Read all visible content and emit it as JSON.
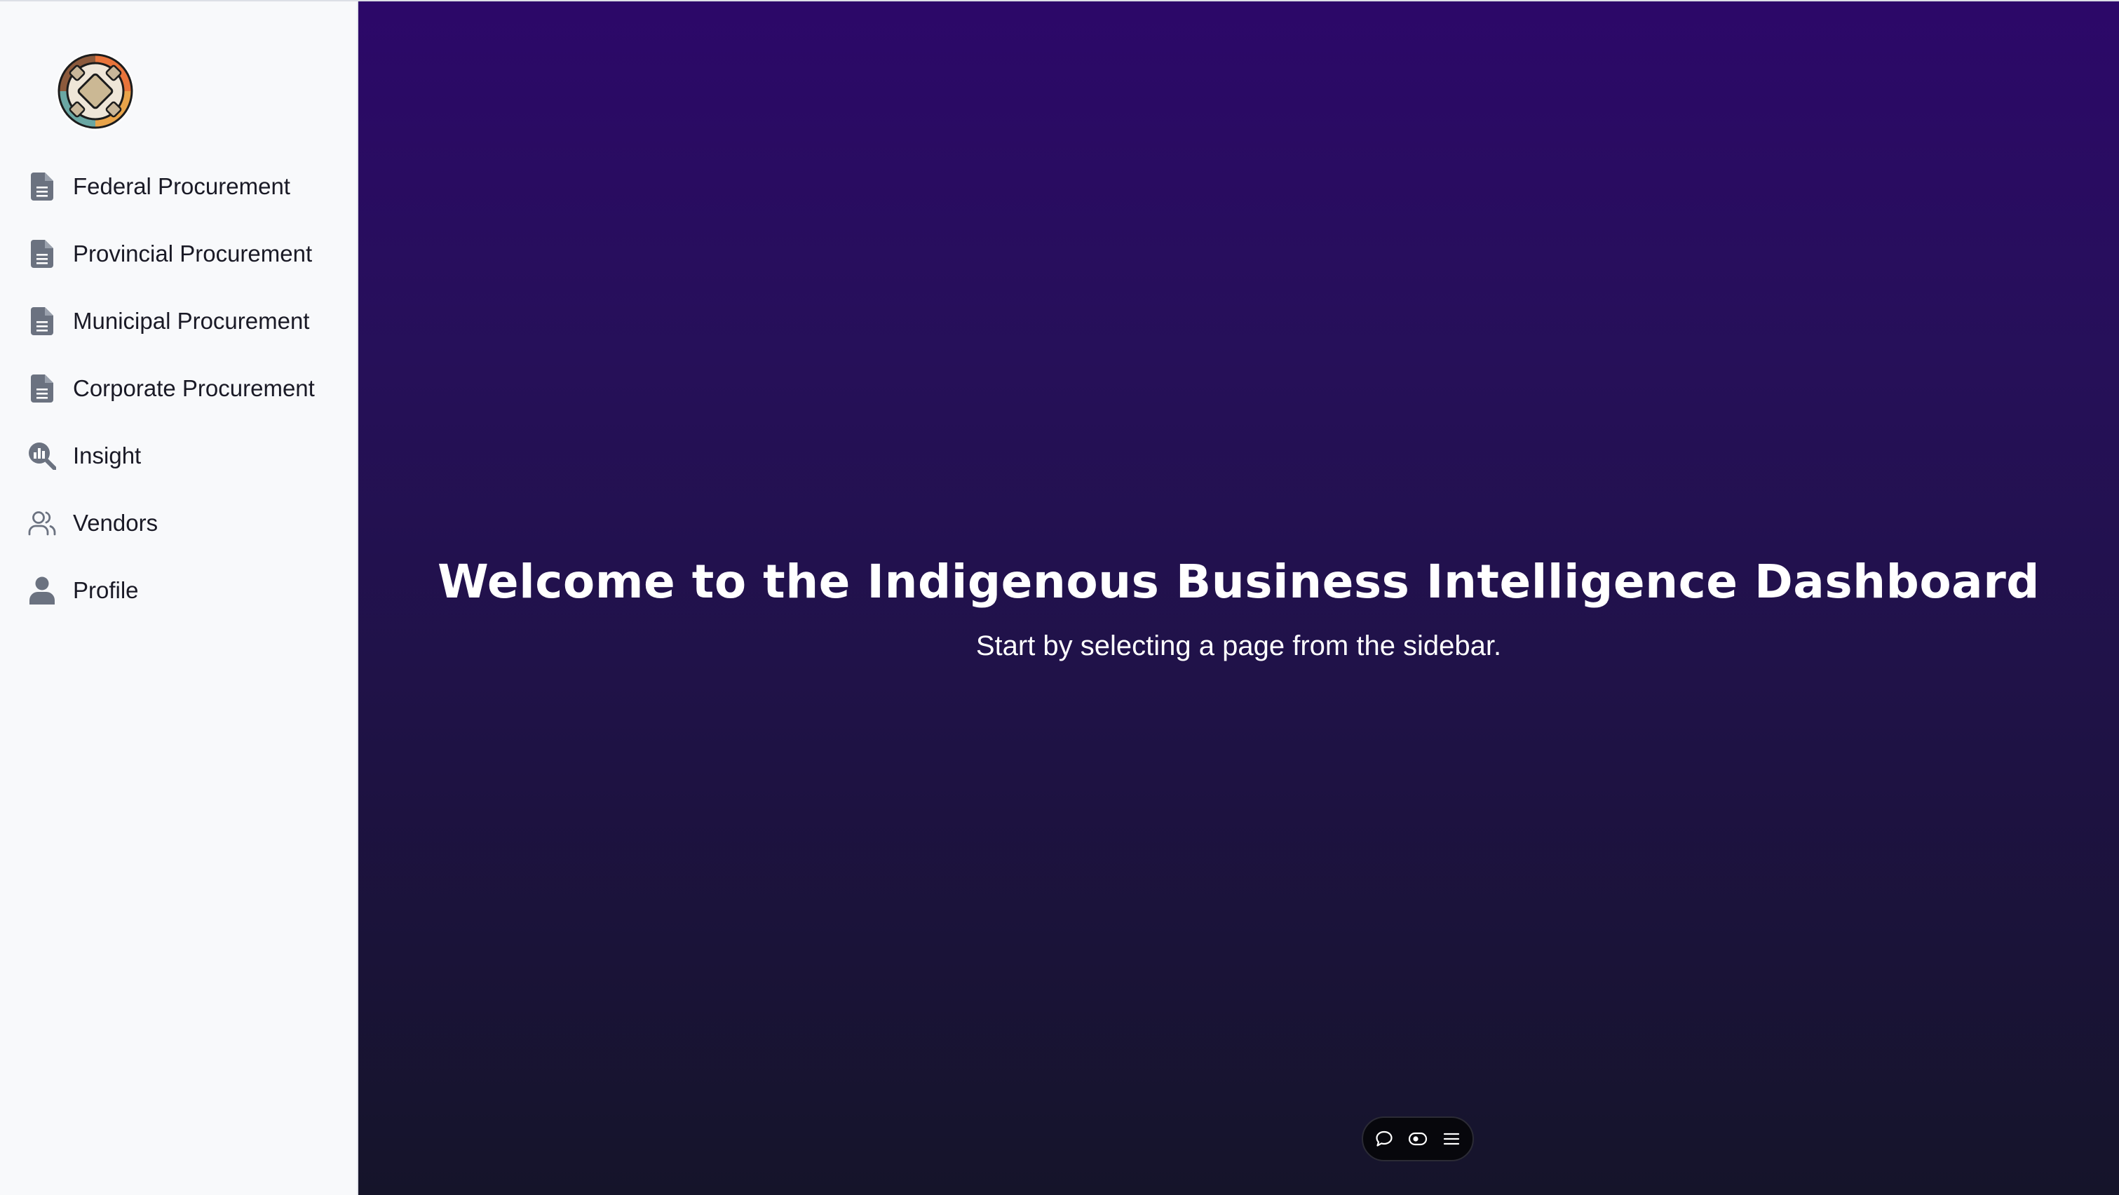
{
  "sidebar": {
    "logo_icon": "indigenous-medicine-wheel-logo",
    "items": [
      {
        "label": "Federal Procurement",
        "icon": "document-icon"
      },
      {
        "label": "Provincial Procurement",
        "icon": "document-icon"
      },
      {
        "label": "Municipal Procurement",
        "icon": "document-icon"
      },
      {
        "label": "Corporate Procurement",
        "icon": "document-icon"
      },
      {
        "label": "Insight",
        "icon": "chart-search-icon"
      },
      {
        "label": "Vendors",
        "icon": "users-icon"
      },
      {
        "label": "Profile",
        "icon": "user-icon"
      }
    ]
  },
  "main": {
    "title": "Welcome to the Indigenous Business Intelligence Dashboard",
    "subtitle": "Start by selecting a page from the sidebar."
  },
  "toolbar": {
    "buttons": [
      "chat-bubble-icon",
      "eye-toggle-icon",
      "menu-icon"
    ]
  },
  "colors": {
    "sidebar_bg": "#f8f9fb",
    "main_gradient_top": "#2c0869",
    "main_gradient_bottom": "#15142a",
    "nav_icon": "#6b7280",
    "text_dark": "#1a1a26",
    "text_light": "#ffffff"
  }
}
